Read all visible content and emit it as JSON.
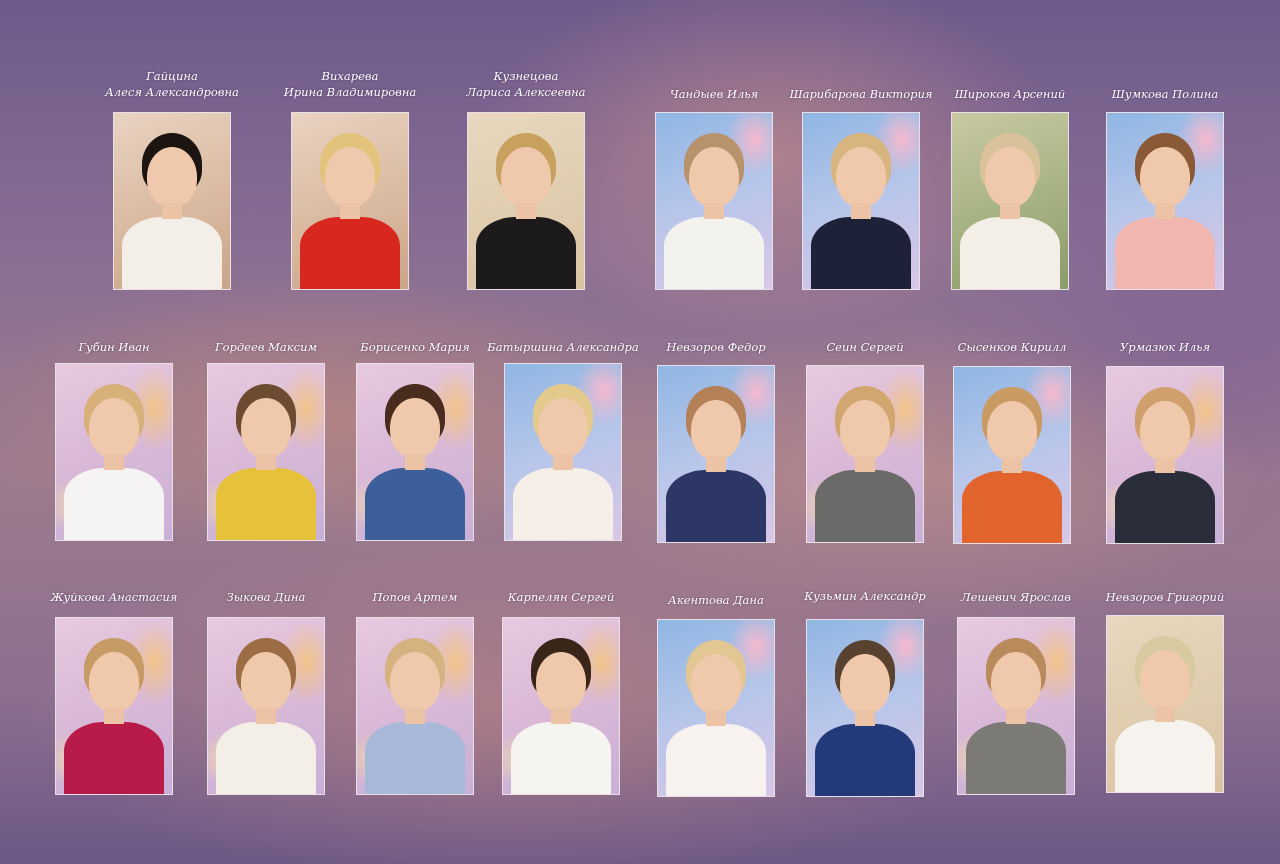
{
  "people": [
    {
      "name": "Гайцина\nАлеся Александровна",
      "bg": "warm",
      "hair": "#1b1411",
      "shirt": "#f3efe8"
    },
    {
      "name": "Вихарева\nИрина Владимировна",
      "bg": "warm",
      "hair": "#e3c27c",
      "shirt": "#d8271f"
    },
    {
      "name": "Кузнецова\nЛариса Алексеевна",
      "bg": "beige",
      "hair": "#c7a15d",
      "shirt": "#1d1a1c"
    },
    {
      "name": "Чандыев Илья",
      "bg": "blue",
      "hair": "#b8926a",
      "shirt": "#f4f2ef"
    },
    {
      "name": "Шарибарова Виктория",
      "bg": "blue",
      "hair": "#d8b57e",
      "shirt": "#1e2238"
    },
    {
      "name": "Широков Арсений",
      "bg": "garden",
      "hair": "#d9c29a",
      "shirt": "#f3eee6"
    },
    {
      "name": "Шумкова Полина",
      "bg": "blue",
      "hair": "#8a5a37",
      "shirt": "#f1b6b0"
    },
    {
      "name": "Губин Иван",
      "bg": "studio",
      "hair": "#d7b07a",
      "shirt": "#f6f4f2"
    },
    {
      "name": "Гордеев Максим",
      "bg": "studio",
      "hair": "#6d4b31",
      "shirt": "#e6c23a"
    },
    {
      "name": "Борисенко Мария",
      "bg": "studio",
      "hair": "#4a2c1f",
      "shirt": "#3c5f9c"
    },
    {
      "name": "Батыршина Александра",
      "bg": "blue",
      "hair": "#e4c98d",
      "shirt": "#f5efe8"
    },
    {
      "name": "Невзоров Федор",
      "bg": "blue",
      "hair": "#b38155",
      "shirt": "#2d3766"
    },
    {
      "name": "Сеин Сергей",
      "bg": "studio",
      "hair": "#d2a66f",
      "shirt": "#6a6a68"
    },
    {
      "name": "Сысенков Кирилл",
      "bg": "blue",
      "hair": "#c99a62",
      "shirt": "#e0642b"
    },
    {
      "name": "Урмазюк Илья",
      "bg": "studio",
      "hair": "#cfa06c",
      "shirt": "#2a2d3a"
    },
    {
      "name": "Жуйкова Анастасия",
      "bg": "studio",
      "hair": "#c79b66",
      "shirt": "#b81a4a"
    },
    {
      "name": "Зыкова Дина",
      "bg": "studio",
      "hair": "#9c6c44",
      "shirt": "#f3eee6"
    },
    {
      "name": "Попов Артем",
      "bg": "studio",
      "hair": "#d6b281",
      "shirt": "#a7b8d9"
    },
    {
      "name": "Карпелян Сергей",
      "bg": "studio",
      "hair": "#3a2619",
      "shirt": "#f6f4f1"
    },
    {
      "name": "Акентова Дана",
      "bg": "blue",
      "hair": "#e2c792",
      "shirt": "#f7f2ef"
    },
    {
      "name": "Кузьмин Александр",
      "bg": "blue",
      "hair": "#5a4230",
      "shirt": "#233a7a"
    },
    {
      "name": "Лешевич Ярослав",
      "bg": "studio",
      "hair": "#b88a5c",
      "shirt": "#7c7a76"
    },
    {
      "name": "Невзоров Григорий",
      "bg": "beige",
      "hair": "#d9c9a0",
      "shirt": "#f6f3ee"
    }
  ]
}
